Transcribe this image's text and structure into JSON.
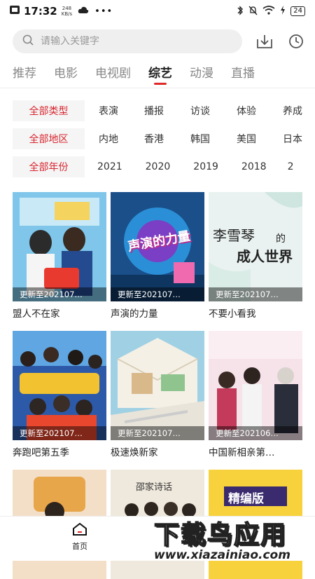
{
  "status_bar": {
    "time": "17:32",
    "net_speed_value": "248",
    "net_speed_unit": "KB/s",
    "dots": "•••",
    "battery": "24"
  },
  "search": {
    "placeholder": "请输入关键字"
  },
  "tabs": [
    {
      "label": "推荐"
    },
    {
      "label": "电影"
    },
    {
      "label": "电视剧"
    },
    {
      "label": "综艺",
      "active": true
    },
    {
      "label": "动漫"
    },
    {
      "label": "直播"
    }
  ],
  "filters": {
    "type": {
      "label": "全部类型",
      "options": [
        "表演",
        "播报",
        "访谈",
        "体验",
        "养成"
      ]
    },
    "region": {
      "label": "全部地区",
      "options": [
        "内地",
        "香港",
        "韩国",
        "美国",
        "日本"
      ]
    },
    "year": {
      "label": "全部年份",
      "options": [
        "2021",
        "2020",
        "2019",
        "2018",
        "2"
      ]
    }
  },
  "shows": [
    {
      "title": "盟人不在家",
      "update": "更新至202107…"
    },
    {
      "title": "声演的力量",
      "update": "更新至202107…"
    },
    {
      "title": "不要小看我",
      "update": "更新至202107…"
    },
    {
      "title": "奔跑吧第五季",
      "update": "更新至202107…"
    },
    {
      "title": "极速焕新家",
      "update": "更新至202107…"
    },
    {
      "title": "中国新相亲第…",
      "update": "更新至202106…"
    },
    {
      "title": "",
      "update": ""
    },
    {
      "title": "",
      "update": ""
    },
    {
      "title": "",
      "update": ""
    }
  ],
  "poster_text": {
    "p2": "声演的力量",
    "p3a": "李雪琴",
    "p3b": "的",
    "p3c": "成人世界",
    "p8": "邵家诗话",
    "p9": "精编版"
  },
  "bottom_nav": {
    "home_label": "首页"
  },
  "watermark": {
    "big": "下载鸟应用",
    "small": "www.xiazainiao.com"
  },
  "colors": {
    "accent": "#e02828",
    "filter_active": "#d8262f"
  }
}
